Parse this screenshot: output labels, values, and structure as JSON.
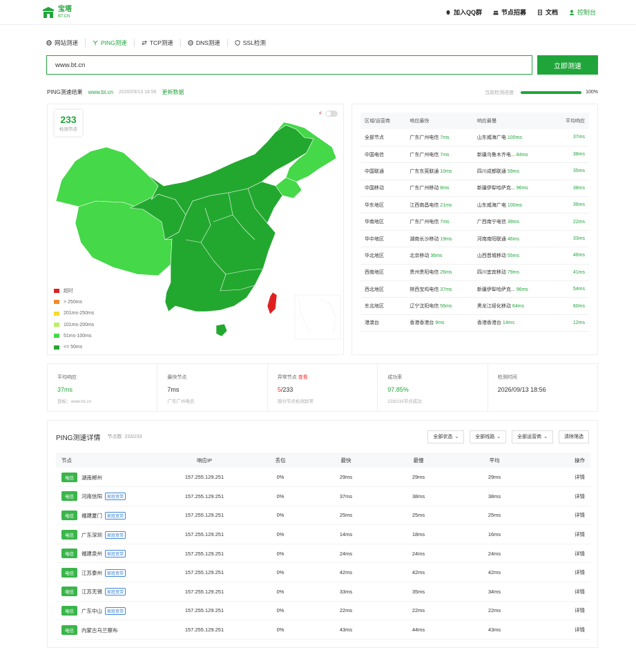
{
  "header": {
    "logo_cn": "宝塔",
    "logo_en": "BT.CN",
    "nav": [
      {
        "label": "加入QQ群",
        "icon": "qq-icon"
      },
      {
        "label": "节点招募",
        "icon": "users-icon"
      },
      {
        "label": "文档",
        "icon": "document-icon"
      },
      {
        "label": "控制台",
        "icon": "user-icon"
      }
    ]
  },
  "tabs": [
    {
      "label": "网站测速",
      "icon": "globe-icon"
    },
    {
      "label": "PING测速",
      "icon": "ping-icon"
    },
    {
      "label": "TCP测速",
      "icon": "tcp-icon"
    },
    {
      "label": "DNS测速",
      "icon": "dns-icon"
    },
    {
      "label": "SSL检测",
      "icon": "shield-icon"
    }
  ],
  "search": {
    "value": "www.bt.cn",
    "button": "立即测速"
  },
  "result": {
    "title": "PING测速结果",
    "domain": "www.bt.cn",
    "time": "2026/09/13 18:56",
    "refresh": "更新数据",
    "progress_label": "当前检测进度",
    "progress": 1.0,
    "progress_text": "100%"
  },
  "map": {
    "node_count": "233",
    "node_label": "检测节点",
    "legend": [
      {
        "label": "超时",
        "color": "#e02020"
      },
      {
        "label": "> 250ms",
        "color": "#f08c2c"
      },
      {
        "label": "201ms-250ms",
        "color": "#f5d92e"
      },
      {
        "label": "101ms-200ms",
        "color": "#b9f064"
      },
      {
        "label": "51ms-100ms",
        "color": "#45d848"
      },
      {
        "label": "<= 50ms",
        "color": "#23a82f"
      }
    ]
  },
  "region_table": {
    "headers": [
      "区域/运营商",
      "响应最快",
      "响应最慢",
      "平均响应"
    ],
    "rows": [
      {
        "region": "全部节点",
        "fast": "广东广州电信",
        "fast_ms": "7ms",
        "slow": "山东威海广电",
        "slow_ms": "100ms",
        "avg": "37ms"
      },
      {
        "region": "中国电信",
        "fast": "广东广州电信",
        "fast_ms": "7ms",
        "slow": "新疆乌鲁木齐电...",
        "slow_ms": "84ms",
        "avg": "38ms"
      },
      {
        "region": "中国联通",
        "fast": "广东东莞联通",
        "fast_ms": "10ms",
        "slow": "四川成都联通",
        "slow_ms": "59ms",
        "avg": "35ms"
      },
      {
        "region": "中国移动",
        "fast": "广东广州移动",
        "fast_ms": "8ms",
        "slow": "新疆伊犁哈萨克...",
        "slow_ms": "96ms",
        "avg": "38ms"
      },
      {
        "region": "华东地区",
        "fast": "江西南昌电信",
        "fast_ms": "21ms",
        "slow": "山东威海广电",
        "slow_ms": "100ms",
        "avg": "36ms"
      },
      {
        "region": "华南地区",
        "fast": "广东广州电信",
        "fast_ms": "7ms",
        "slow": "广西南宁电信",
        "slow_ms": "39ms",
        "avg": "22ms"
      },
      {
        "region": "华中地区",
        "fast": "湖南长沙移动",
        "fast_ms": "19ms",
        "slow": "河南南阳联通",
        "slow_ms": "46ms",
        "avg": "33ms"
      },
      {
        "region": "华北地区",
        "fast": "北京移动",
        "fast_ms": "36ms",
        "slow": "山西晋城移动",
        "slow_ms": "55ms",
        "avg": "46ms"
      },
      {
        "region": "西南地区",
        "fast": "贵州贵阳电信",
        "fast_ms": "26ms",
        "slow": "四川宜宾移动",
        "slow_ms": "79ms",
        "avg": "41ms"
      },
      {
        "region": "西北地区",
        "fast": "陕西宝鸡电信",
        "fast_ms": "37ms",
        "slow": "新疆伊犁哈萨克...",
        "slow_ms": "96ms",
        "avg": "54ms"
      },
      {
        "region": "东北地区",
        "fast": "辽宁沈阳电信",
        "fast_ms": "56ms",
        "slow": "黑龙江绥化移动",
        "slow_ms": "64ms",
        "avg": "60ms"
      },
      {
        "region": "港澳台",
        "fast": "香港香港台",
        "fast_ms": "9ms",
        "slow": "香港香港台",
        "slow_ms": "14ms",
        "avg": "12ms"
      }
    ]
  },
  "stats": [
    {
      "label": "平均响应",
      "value": "37ms",
      "sub": "目标：www.bt.cn"
    },
    {
      "label": "最快节点",
      "value": "7ms",
      "sub": "广东广州电信"
    },
    {
      "label": "异常节点",
      "link": "查看",
      "value_red": "5",
      "value_rest": "/233",
      "sub": "部分节点检测异常"
    },
    {
      "label": "成功率",
      "value": "97.85%",
      "sub": "228/233节点成功"
    },
    {
      "label": "检测时间",
      "value": "2026/09/13 18:56",
      "sub": ""
    }
  ],
  "details": {
    "title": "PING测速详情",
    "count_label": "节点数",
    "count": "233/233",
    "filters": [
      "全部状态",
      "全部线路",
      "全部运营商"
    ],
    "clear": "清除筛选",
    "headers": [
      "节点",
      "响应IP",
      "丢包",
      "最快",
      "最慢",
      "平均",
      "操作"
    ],
    "rows": [
      {
        "isp": "电信",
        "node": "湖南郴州",
        "tag": "",
        "ip": "157.255.129.251",
        "loss": "0%",
        "min": "29ms",
        "max": "29ms",
        "avg": "29ms",
        "op": "详情"
      },
      {
        "isp": "电信",
        "node": "河南信阳",
        "tag": "家庭宽带",
        "ip": "157.255.129.251",
        "loss": "0%",
        "min": "37ms",
        "max": "38ms",
        "avg": "38ms",
        "op": "详情"
      },
      {
        "isp": "电信",
        "node": "福建厦门",
        "tag": "家庭宽带",
        "ip": "157.255.129.251",
        "loss": "0%",
        "min": "25ms",
        "max": "25ms",
        "avg": "25ms",
        "op": "详情"
      },
      {
        "isp": "电信",
        "node": "广东深圳",
        "tag": "家庭宽带",
        "ip": "157.255.129.251",
        "loss": "0%",
        "min": "14ms",
        "max": "18ms",
        "avg": "16ms",
        "op": "详情"
      },
      {
        "isp": "电信",
        "node": "福建泉州",
        "tag": "家庭宽带",
        "ip": "157.255.129.251",
        "loss": "0%",
        "min": "24ms",
        "max": "24ms",
        "avg": "24ms",
        "op": "详情"
      },
      {
        "isp": "电信",
        "node": "江苏泰州",
        "tag": "家庭宽带",
        "ip": "157.255.129.251",
        "loss": "0%",
        "min": "42ms",
        "max": "42ms",
        "avg": "42ms",
        "op": "详情"
      },
      {
        "isp": "电信",
        "node": "江苏无锡",
        "tag": "家庭宽带",
        "ip": "157.255.129.251",
        "loss": "0%",
        "min": "33ms",
        "max": "35ms",
        "avg": "34ms",
        "op": "详情"
      },
      {
        "isp": "电信",
        "node": "广东中山",
        "tag": "家庭宽带",
        "ip": "157.255.129.251",
        "loss": "0%",
        "min": "22ms",
        "max": "22ms",
        "avg": "22ms",
        "op": "详情"
      },
      {
        "isp": "电信",
        "node": "内蒙古乌兰察布",
        "tag": "",
        "ip": "157.255.129.251",
        "loss": "0%",
        "min": "43ms",
        "max": "44ms",
        "avg": "43ms",
        "op": "详情"
      }
    ]
  }
}
